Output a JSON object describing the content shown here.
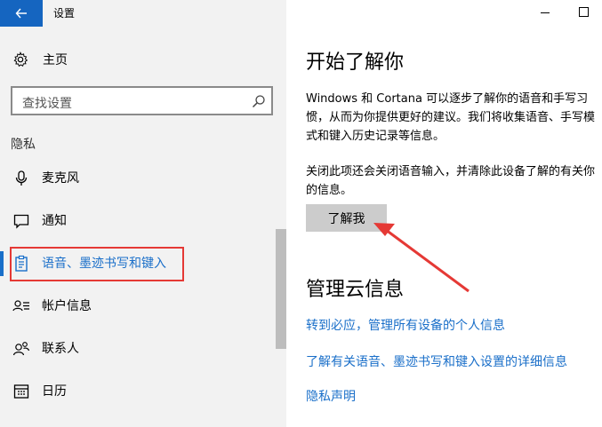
{
  "titlebar": {
    "title": "设置"
  },
  "left": {
    "home_label": "主页",
    "search_placeholder": "查找设置",
    "section_label": "隐私",
    "items": [
      {
        "label": "麦克风",
        "icon": "microphone-icon"
      },
      {
        "label": "通知",
        "icon": "notification-icon"
      },
      {
        "label": "语音、墨迹书写和键入",
        "icon": "clipboard-icon",
        "active": true
      },
      {
        "label": "帐户信息",
        "icon": "account-info-icon"
      },
      {
        "label": "联系人",
        "icon": "contacts-icon"
      },
      {
        "label": "日历",
        "icon": "calendar-icon"
      }
    ]
  },
  "main": {
    "heading1": "开始了解你",
    "para1": "Windows 和 Cortana 可以逐步了解你的语音和手写习惯，从而为你提供更好的建议。我们将收集语音、手写模式和键入历史记录等信息。",
    "para2": "关闭此项还会关闭语音输入，并清除此设备了解的有关你的信息。",
    "button_label": "了解我",
    "heading2": "管理云信息",
    "links": [
      "转到必应，管理所有设备的个人信息",
      "了解有关语音、墨迹书写和键入设置的详细信息",
      "隐私声明"
    ]
  },
  "colors": {
    "accent": "#1a6fc9",
    "back_button": "#1565c0",
    "annotation_red": "#e53935",
    "sidebar_bg": "#f2f2f2"
  }
}
